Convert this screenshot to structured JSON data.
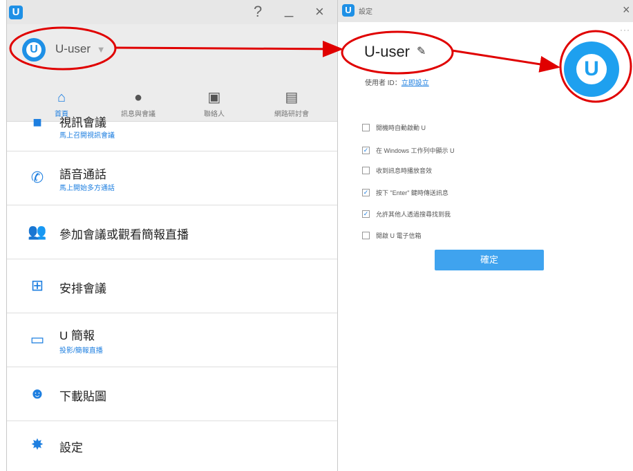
{
  "main_window": {
    "app_logo_letter": "U",
    "titlebar_buttons": {
      "help": "?",
      "minimize": "_",
      "close": "×"
    },
    "user": {
      "name": "U-user",
      "caret": "▼",
      "avatar_letter": "U"
    },
    "nav": [
      {
        "label": "首頁",
        "icon": "home-icon",
        "glyph": "⌂"
      },
      {
        "label": "訊息與會議",
        "icon": "chat-icon",
        "glyph": "●"
      },
      {
        "label": "聯絡人",
        "icon": "contacts-icon",
        "glyph": "▣"
      },
      {
        "label": "網路研討會",
        "icon": "webinar-icon",
        "glyph": "▤"
      }
    ],
    "menu": [
      {
        "title": "視訊會議",
        "sub": "馬上召開視訊會議",
        "icon": "video-camera-icon",
        "glyph": "■"
      },
      {
        "title": "語音通話",
        "sub": "馬上開始多方通話",
        "icon": "phone-icon",
        "glyph": "✆"
      },
      {
        "title": "參加會議或觀看簡報直播",
        "sub": "",
        "icon": "join-people-icon",
        "glyph": "👥"
      },
      {
        "title": "安排會議",
        "sub": "",
        "icon": "calendar-add-icon",
        "glyph": "⊞"
      },
      {
        "title": "U 簡報",
        "sub": "投影/簡報直播",
        "icon": "presentation-icon",
        "glyph": "▭"
      },
      {
        "title": "下載貼圖",
        "sub": "",
        "icon": "smiley-icon",
        "glyph": "☻"
      },
      {
        "title": "設定",
        "sub": "",
        "icon": "gear-icon",
        "glyph": "✸"
      }
    ]
  },
  "settings_window": {
    "title": "設定",
    "logo_letter": "U",
    "close": "×",
    "more": "···",
    "user_name": "U-user",
    "pencil": "✎",
    "id_label": "使用者 ID：",
    "id_link": "立即設立",
    "avatar_letter": "U",
    "options": [
      {
        "label": "開機時自動啟動 U",
        "checked": false
      },
      {
        "label": "在 Windows 工作列中顯示 U",
        "checked": true
      },
      {
        "label": "收到訊息時播放音效",
        "checked": false
      },
      {
        "label": "按下 \"Enter\" 鍵時傳送訊息",
        "checked": true
      },
      {
        "label": "允許其他人透過搜尋找到我",
        "checked": true
      },
      {
        "label": "開啟 U 電子信箱",
        "checked": false
      }
    ],
    "confirm_label": "確定"
  },
  "colors": {
    "accent": "#1e7fe0",
    "annotation": "#e00000"
  }
}
